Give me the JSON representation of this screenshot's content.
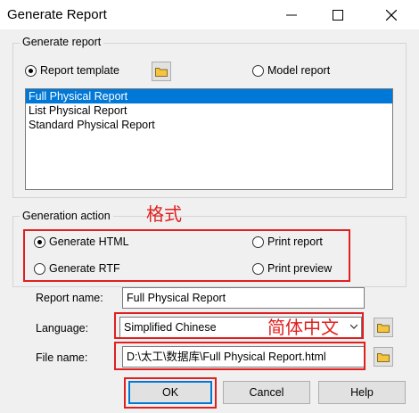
{
  "window": {
    "title": "Generate Report"
  },
  "report_group": {
    "label": "Generate report",
    "report_template_label": "Report template",
    "model_report_label": "Model report",
    "items": [
      "Full Physical Report",
      "List Physical Report",
      "Standard Physical Report"
    ],
    "selected_item": "Full Physical Report"
  },
  "action_group": {
    "label": "Generation action",
    "generate_html": "Generate HTML",
    "generate_rtf": "Generate RTF",
    "print_report": "Print report",
    "print_preview": "Print preview"
  },
  "fields": {
    "report_name_label": "Report name:",
    "report_name_value": "Full Physical Report",
    "language_label": "Language:",
    "language_value": "Simplified Chinese",
    "file_name_label": "File name:",
    "file_name_value": "D:\\太工\\数据库\\Full Physical Report.html"
  },
  "buttons": {
    "ok": "OK",
    "cancel": "Cancel",
    "help": "Help"
  },
  "annotations": {
    "format": "格式",
    "simplified_chinese": "简体中文"
  },
  "colors": {
    "selection": "#0078d7",
    "annotation_red": "#e02020",
    "default_border": "#0078d7"
  },
  "icons": [
    "close-icon",
    "maximize-icon",
    "minimize-icon",
    "folder-icon",
    "chevron-down-icon"
  ]
}
